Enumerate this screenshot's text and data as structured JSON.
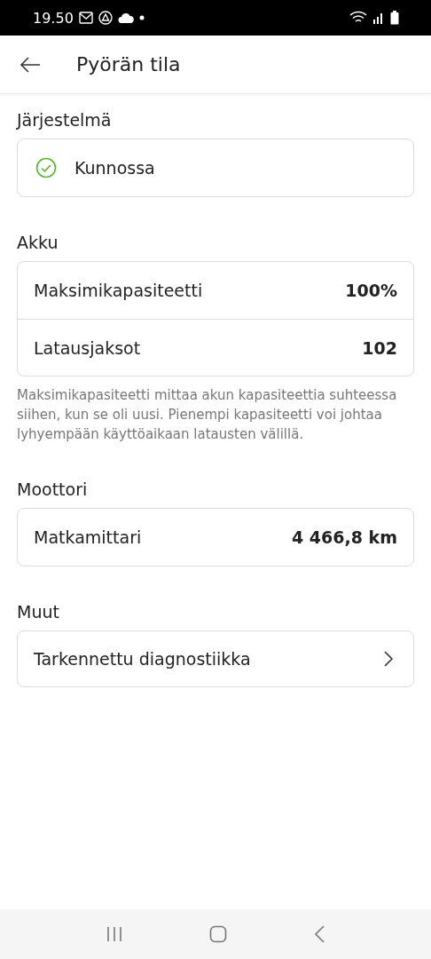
{
  "status_bar": {
    "time": "19.50"
  },
  "header": {
    "title": "Pyörän tila"
  },
  "sections": [
    {
      "title": "Järjestelmä",
      "kind": "status",
      "status": {
        "label": "Kunnossa",
        "ok": true
      }
    },
    {
      "title": "Akku",
      "kind": "rows",
      "rows": [
        {
          "label": "Maksimikapasiteetti",
          "value": "100%"
        },
        {
          "label": "Latausjaksot",
          "value": "102"
        }
      ],
      "note": "Maksimikapasiteetti mittaa akun kapasiteettia suhteessa siihen, kun se oli uusi. Pienempi kapasiteetti voi johtaa lyhyempään käyttöaikaan latausten välillä."
    },
    {
      "title": "Moottori",
      "kind": "rows",
      "rows": [
        {
          "label": "Matkamittari",
          "value": "4 466,8 km"
        }
      ]
    },
    {
      "title": "Muut",
      "kind": "link",
      "link": {
        "label": "Tarkennettu diagnostiikka"
      }
    }
  ]
}
